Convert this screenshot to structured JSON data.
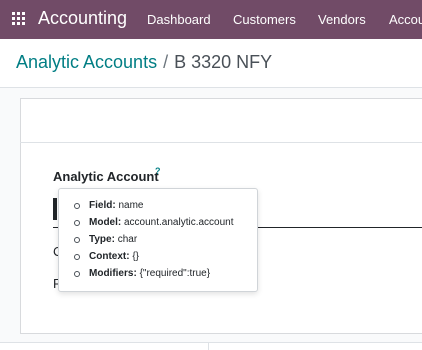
{
  "navbar": {
    "app_name": "Accounting",
    "menu": [
      "Dashboard",
      "Customers",
      "Vendors",
      "Accou"
    ]
  },
  "breadcrumb": {
    "parent": "Analytic Accounts",
    "separator": "/",
    "current": "B 3320 NFY"
  },
  "form": {
    "field_label": "Analytic Account",
    "help_mark": "?",
    "name_value": "",
    "label_2_initial": "C",
    "label_3_initial": "R"
  },
  "tooltip": {
    "rows": [
      {
        "key": "Field:",
        "value": "name"
      },
      {
        "key": "Model:",
        "value": "account.analytic.account"
      },
      {
        "key": "Type:",
        "value": "char"
      },
      {
        "key": "Context:",
        "value": "{}"
      },
      {
        "key": "Modifiers:",
        "value": "{\"required\":true}"
      }
    ]
  },
  "colors": {
    "navbar": "#714b67",
    "link": "#017e84"
  }
}
